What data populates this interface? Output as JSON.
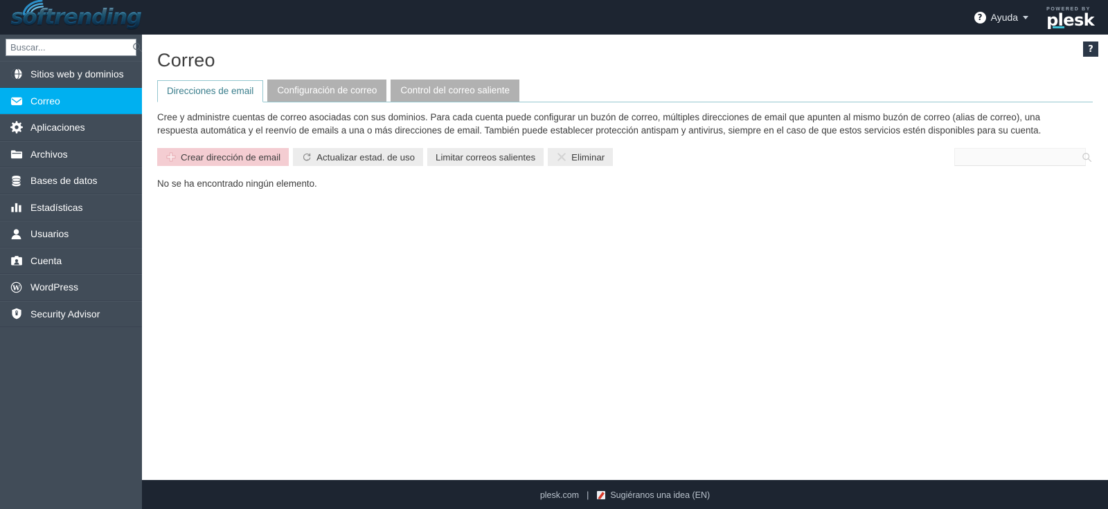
{
  "brand": {
    "logo_text": "softrending",
    "logo_icon": "wifi-arc-icon"
  },
  "sidebar": {
    "search": {
      "placeholder": "Buscar...",
      "value": "",
      "icon": "search-icon"
    },
    "items": [
      {
        "label": "Sitios web y dominios",
        "icon": "globe-icon",
        "active": false
      },
      {
        "label": "Correo",
        "icon": "envelope-icon",
        "active": true
      },
      {
        "label": "Aplicaciones",
        "icon": "gear-icon",
        "active": false
      },
      {
        "label": "Archivos",
        "icon": "folder-icon",
        "active": false
      },
      {
        "label": "Bases de datos",
        "icon": "database-icon",
        "active": false
      },
      {
        "label": "Estadísticas",
        "icon": "bar-chart-icon",
        "active": false
      },
      {
        "label": "Usuarios",
        "icon": "user-icon",
        "active": false
      },
      {
        "label": "Cuenta",
        "icon": "id-card-icon",
        "active": false
      },
      {
        "label": "WordPress",
        "icon": "wordpress-icon",
        "active": false
      },
      {
        "label": "Security Advisor",
        "icon": "shield-icon",
        "active": false
      }
    ]
  },
  "topbar": {
    "help_label": "Ayuda",
    "help_icon": "question-circle-icon",
    "caret_icon": "chevron-down-icon",
    "powered_by": "POWERED BY",
    "plesk_word": "plesk"
  },
  "main": {
    "help_toggle_label": "?",
    "title": "Correo",
    "tabs": [
      {
        "label": "Direcciones de email",
        "active": true
      },
      {
        "label": "Configuración de correo",
        "active": false
      },
      {
        "label": "Control del correo saliente",
        "active": false
      }
    ],
    "description": "Cree y administre cuentas de correo asociadas con sus dominios. Para cada cuenta puede configurar un buzón de correo, múltiples direcciones de email que apunten al mismo buzón de correo (alias de correo), una respuesta automática y el reenvío de emails a una o más direcciones de email. También puede establecer protección antispam y antivirus, siempre en el caso de que estos servicios estén disponibles para su cuenta.",
    "toolbar": [
      {
        "label": "Crear dirección de email",
        "icon": "plus-icon",
        "style": "primary"
      },
      {
        "label": "Actualizar estad. de uso",
        "icon": "refresh-icon",
        "style": "default"
      },
      {
        "label": "Limitar correos salientes",
        "icon": "none",
        "style": "default"
      },
      {
        "label": "Eliminar",
        "icon": "remove-x-icon",
        "style": "default"
      }
    ],
    "list_search": {
      "placeholder": "",
      "value": "",
      "icon": "search-icon"
    },
    "empty_message": "No se ha encontrado ningún elemento."
  },
  "footer": {
    "site_link": "plesk.com",
    "separator": "|",
    "idea_link": "Sugiéranos una idea (EN)",
    "idea_icon": "note-pencil-icon"
  },
  "colors": {
    "sidebar_bg": "#414c58",
    "header_bg": "#1d2531",
    "accent_active": "#00b0f0",
    "tab_active_border": "#93c6cf",
    "tab_active_text": "#3a7e8c",
    "primary_button_bg": "#f4cdd2",
    "plesk_underline": "#3fc4d9"
  }
}
